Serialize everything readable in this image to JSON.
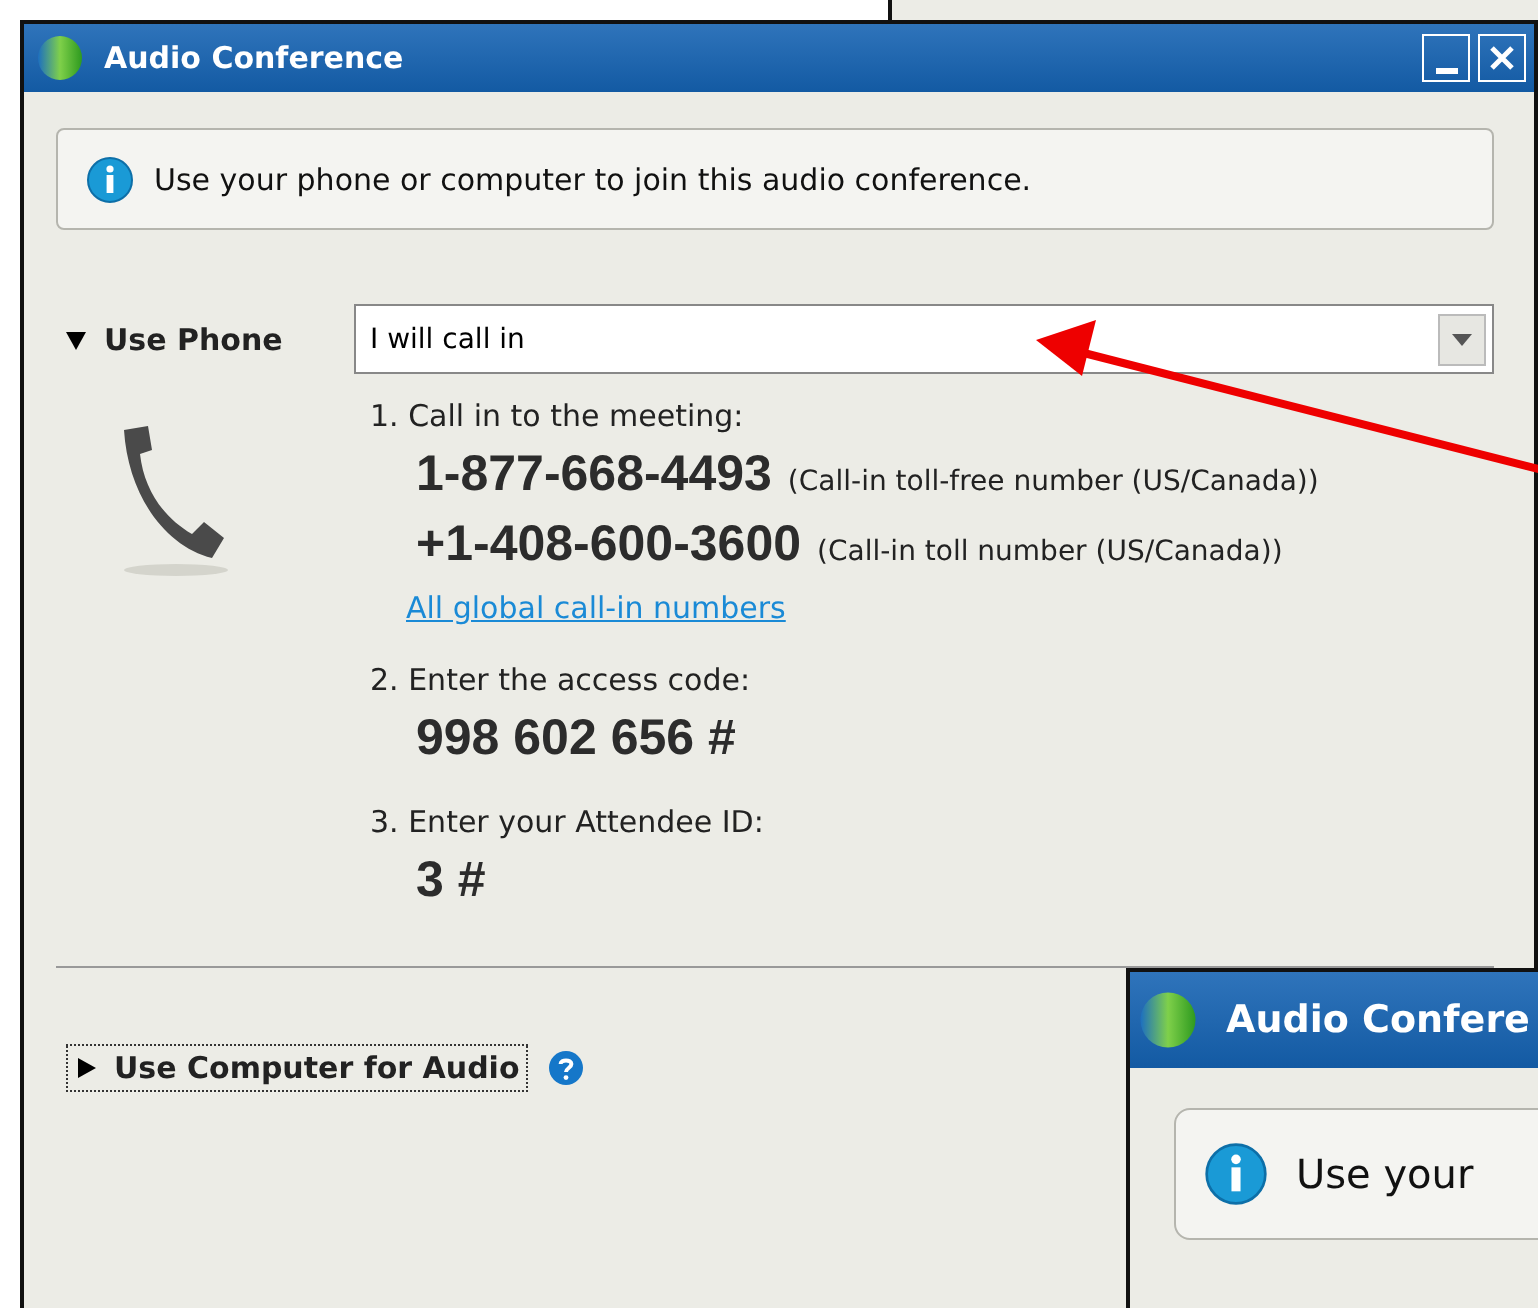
{
  "window": {
    "title": "Audio Conference"
  },
  "info": {
    "text": "Use your phone or computer to join this audio conference."
  },
  "phone_section": {
    "label": "Use Phone",
    "expanded": true,
    "mode": {
      "value": "I will call in"
    },
    "steps": [
      {
        "label": "1. Call in to the meeting:",
        "numbers": [
          {
            "number": "1-877-668-4493",
            "note": "(Call-in toll-free number (US/Canada))"
          },
          {
            "number": "+1-408-600-3600",
            "note": "(Call-in toll number (US/Canada))"
          }
        ],
        "link": "All global call-in numbers"
      },
      {
        "label": "2. Enter the access code:",
        "numbers": [
          {
            "number": "998 602 656 #"
          }
        ]
      },
      {
        "label": "3. Enter your Attendee ID:",
        "numbers": [
          {
            "number": "3 #"
          }
        ]
      }
    ]
  },
  "computer_section": {
    "label": "Use Computer for Audio",
    "expanded": false
  },
  "overlay_window": {
    "title": "Audio Confere",
    "info": "Use your"
  }
}
